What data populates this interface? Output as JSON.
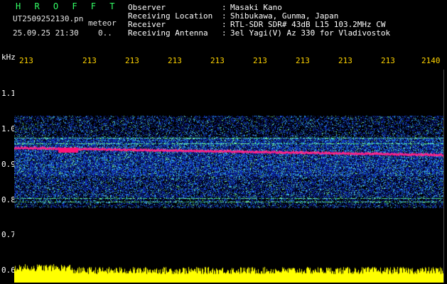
{
  "header": {
    "app_name": "H R O F F T",
    "filename": "UT2509252130.pn",
    "tag": "meteor",
    "datetime": "25.09.25 21:30",
    "flag": "0.."
  },
  "meta": [
    {
      "label": "Observer",
      "value": "Masaki Kano"
    },
    {
      "label": "Receiving Location",
      "value": "Shibukawa, Gunma, Japan"
    },
    {
      "label": "Receiver",
      "value": "RTL-SDR SDR# 43dB L15 103.2MHz CW"
    },
    {
      "label": "Receiving Antenna",
      "value": "3el Yagi(V) Az 330 for Vladivostok"
    }
  ],
  "axis": {
    "unit": "kHz",
    "x_ticks": [
      "213",
      "213",
      "213",
      "213",
      "213",
      "213",
      "213",
      "213",
      "213",
      "2140"
    ],
    "y_ticks": [
      "1.1",
      "1.0",
      "0.9",
      "0.8",
      "0.7",
      "0.6"
    ]
  },
  "colors": {
    "background": "#000000",
    "title": "#33ff66",
    "tick": "#ffd400",
    "signal": "#ff2288",
    "noise_floor": "#ffff00"
  }
}
